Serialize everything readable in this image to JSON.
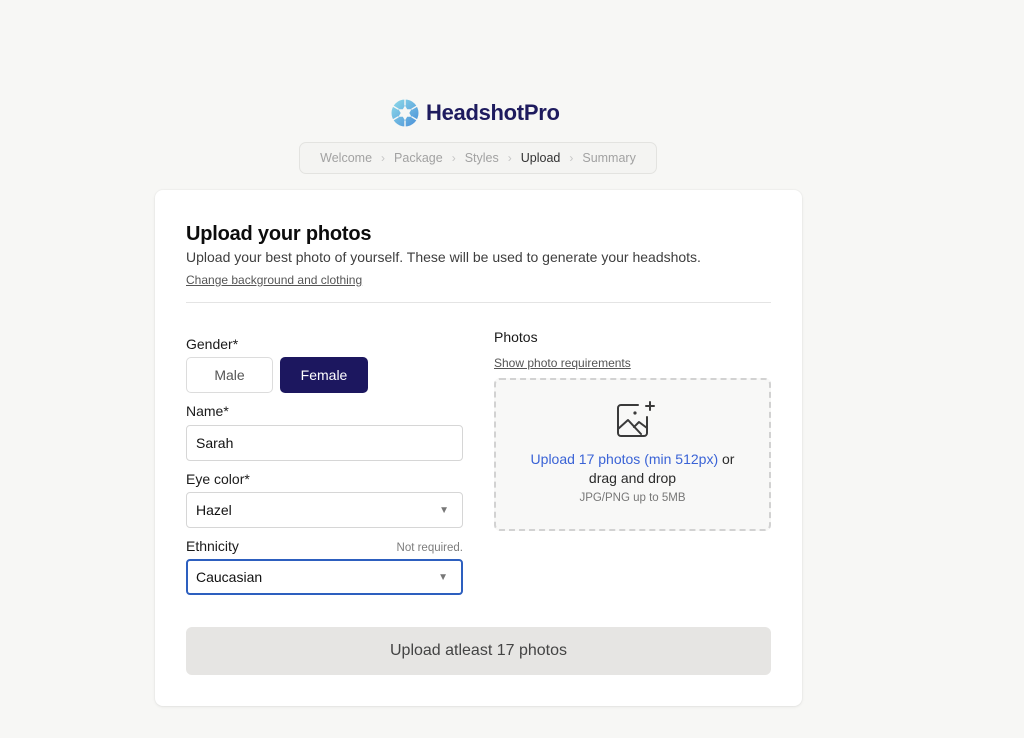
{
  "brand": {
    "name": "HeadshotPro",
    "logo_icon": "headshotpro-logo-icon",
    "colors": {
      "primary": "#1c175f",
      "logo_light": "#7fd3e8",
      "logo_dark": "#4a8fd8",
      "link_accent": "#3a63d6",
      "focus": "#2d5fbf"
    }
  },
  "breadcrumb": {
    "items": [
      {
        "label": "Welcome",
        "active": false
      },
      {
        "label": "Package",
        "active": false
      },
      {
        "label": "Styles",
        "active": false
      },
      {
        "label": "Upload",
        "active": true
      },
      {
        "label": "Summary",
        "active": false
      }
    ],
    "separator": "›"
  },
  "card": {
    "title": "Upload your photos",
    "subtitle": "Upload your best photo of yourself. These will be used to generate your headshots.",
    "change_link": "Change background and clothing"
  },
  "form": {
    "gender": {
      "label": "Gender*",
      "options": [
        "Male",
        "Female"
      ],
      "selected": "Female"
    },
    "name": {
      "label": "Name*",
      "value": "Sarah"
    },
    "eye_color": {
      "label": "Eye color*",
      "value": "Hazel"
    },
    "ethnicity": {
      "label": "Ethnicity",
      "hint": "Not required.",
      "value": "Caucasian"
    }
  },
  "photos": {
    "label": "Photos",
    "requirements_link": "Show photo requirements",
    "dropzone": {
      "icon": "image-add-icon",
      "cta": "Upload 17 photos (min 512px)",
      "cta_suffix": " or",
      "line2": "drag and drop",
      "formats": "JPG/PNG up to 5MB"
    }
  },
  "submit": {
    "label": "Upload atleast 17 photos",
    "enabled": false
  }
}
